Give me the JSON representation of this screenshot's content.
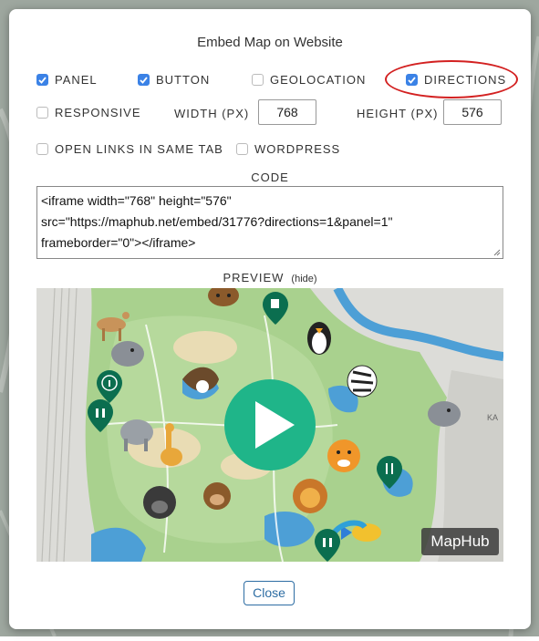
{
  "dialog": {
    "title": "Embed Map on Website"
  },
  "options": {
    "panel": {
      "label": "PANEL",
      "checked": true
    },
    "button": {
      "label": "BUTTON",
      "checked": true
    },
    "geolocation": {
      "label": "GEOLOCATION",
      "checked": false
    },
    "directions": {
      "label": "DIRECTIONS",
      "checked": true
    },
    "responsive": {
      "label": "RESPONSIVE",
      "checked": false
    },
    "open_links": {
      "label": "OPEN LINKS IN SAME TAB",
      "checked": false
    },
    "wordpress": {
      "label": "WORDPRESS",
      "checked": false
    }
  },
  "size": {
    "width_label": "WIDTH (PX)",
    "width_value": "768",
    "height_label": "HEIGHT (PX)",
    "height_value": "576"
  },
  "code": {
    "label": "CODE",
    "lines": [
      "<iframe width=\"768\" height=\"576\"",
      "src=\"https://maphub.net/embed/31776?directions=1&panel=1\"",
      "frameborder=\"0\"></iframe>"
    ]
  },
  "preview": {
    "label": "PREVIEW",
    "hide_link": "(hide)",
    "brand": "MapHub",
    "street_label": "KA"
  },
  "footer": {
    "close_label": "Close"
  },
  "colors": {
    "accent": "#3b82e6",
    "annotation": "#d32121",
    "play": "#1fb589",
    "marker": "#0b6e4f",
    "link": "#2d6da3"
  }
}
